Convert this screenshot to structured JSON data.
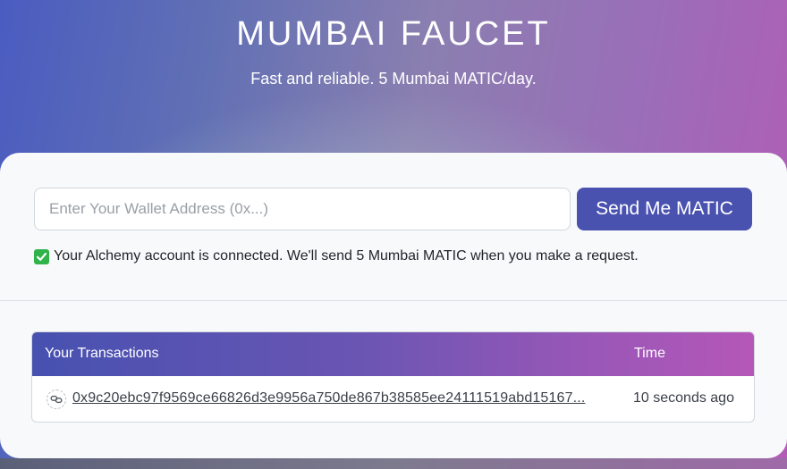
{
  "header": {
    "title": "MUMBAI FAUCET",
    "subtitle": "Fast and reliable. 5 Mumbai MATIC/day."
  },
  "form": {
    "wallet_placeholder": "Enter Your Wallet Address (0x...)",
    "wallet_value": "",
    "send_label": "Send Me MATIC"
  },
  "status": {
    "icon": "check-icon",
    "message": "Your Alchemy account is connected. We'll send 5 Mumbai MATIC when you make a request."
  },
  "transactions": {
    "columns": {
      "hash": "Your Transactions",
      "time": "Time"
    },
    "rows": [
      {
        "icon": "link-icon",
        "hash": "0x9c20ebc97f9569ce66826d3e9956a750de867b38585ee24111519abd15167...",
        "time": "10 seconds ago"
      }
    ]
  },
  "colors": {
    "accent": "#4a52b0",
    "success": "#2fb34a",
    "gradient_start": "#4a5cc0",
    "gradient_end": "#b35cb6"
  }
}
